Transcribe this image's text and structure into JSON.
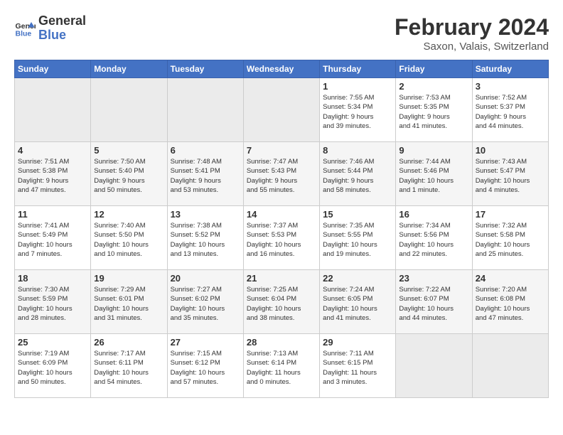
{
  "header": {
    "logo_line1": "General",
    "logo_line2": "Blue",
    "month": "February 2024",
    "location": "Saxon, Valais, Switzerland"
  },
  "weekdays": [
    "Sunday",
    "Monday",
    "Tuesday",
    "Wednesday",
    "Thursday",
    "Friday",
    "Saturday"
  ],
  "weeks": [
    [
      {
        "day": "",
        "info": ""
      },
      {
        "day": "",
        "info": ""
      },
      {
        "day": "",
        "info": ""
      },
      {
        "day": "",
        "info": ""
      },
      {
        "day": "1",
        "info": "Sunrise: 7:55 AM\nSunset: 5:34 PM\nDaylight: 9 hours\nand 39 minutes."
      },
      {
        "day": "2",
        "info": "Sunrise: 7:53 AM\nSunset: 5:35 PM\nDaylight: 9 hours\nand 41 minutes."
      },
      {
        "day": "3",
        "info": "Sunrise: 7:52 AM\nSunset: 5:37 PM\nDaylight: 9 hours\nand 44 minutes."
      }
    ],
    [
      {
        "day": "4",
        "info": "Sunrise: 7:51 AM\nSunset: 5:38 PM\nDaylight: 9 hours\nand 47 minutes."
      },
      {
        "day": "5",
        "info": "Sunrise: 7:50 AM\nSunset: 5:40 PM\nDaylight: 9 hours\nand 50 minutes."
      },
      {
        "day": "6",
        "info": "Sunrise: 7:48 AM\nSunset: 5:41 PM\nDaylight: 9 hours\nand 53 minutes."
      },
      {
        "day": "7",
        "info": "Sunrise: 7:47 AM\nSunset: 5:43 PM\nDaylight: 9 hours\nand 55 minutes."
      },
      {
        "day": "8",
        "info": "Sunrise: 7:46 AM\nSunset: 5:44 PM\nDaylight: 9 hours\nand 58 minutes."
      },
      {
        "day": "9",
        "info": "Sunrise: 7:44 AM\nSunset: 5:46 PM\nDaylight: 10 hours\nand 1 minute."
      },
      {
        "day": "10",
        "info": "Sunrise: 7:43 AM\nSunset: 5:47 PM\nDaylight: 10 hours\nand 4 minutes."
      }
    ],
    [
      {
        "day": "11",
        "info": "Sunrise: 7:41 AM\nSunset: 5:49 PM\nDaylight: 10 hours\nand 7 minutes."
      },
      {
        "day": "12",
        "info": "Sunrise: 7:40 AM\nSunset: 5:50 PM\nDaylight: 10 hours\nand 10 minutes."
      },
      {
        "day": "13",
        "info": "Sunrise: 7:38 AM\nSunset: 5:52 PM\nDaylight: 10 hours\nand 13 minutes."
      },
      {
        "day": "14",
        "info": "Sunrise: 7:37 AM\nSunset: 5:53 PM\nDaylight: 10 hours\nand 16 minutes."
      },
      {
        "day": "15",
        "info": "Sunrise: 7:35 AM\nSunset: 5:55 PM\nDaylight: 10 hours\nand 19 minutes."
      },
      {
        "day": "16",
        "info": "Sunrise: 7:34 AM\nSunset: 5:56 PM\nDaylight: 10 hours\nand 22 minutes."
      },
      {
        "day": "17",
        "info": "Sunrise: 7:32 AM\nSunset: 5:58 PM\nDaylight: 10 hours\nand 25 minutes."
      }
    ],
    [
      {
        "day": "18",
        "info": "Sunrise: 7:30 AM\nSunset: 5:59 PM\nDaylight: 10 hours\nand 28 minutes."
      },
      {
        "day": "19",
        "info": "Sunrise: 7:29 AM\nSunset: 6:01 PM\nDaylight: 10 hours\nand 31 minutes."
      },
      {
        "day": "20",
        "info": "Sunrise: 7:27 AM\nSunset: 6:02 PM\nDaylight: 10 hours\nand 35 minutes."
      },
      {
        "day": "21",
        "info": "Sunrise: 7:25 AM\nSunset: 6:04 PM\nDaylight: 10 hours\nand 38 minutes."
      },
      {
        "day": "22",
        "info": "Sunrise: 7:24 AM\nSunset: 6:05 PM\nDaylight: 10 hours\nand 41 minutes."
      },
      {
        "day": "23",
        "info": "Sunrise: 7:22 AM\nSunset: 6:07 PM\nDaylight: 10 hours\nand 44 minutes."
      },
      {
        "day": "24",
        "info": "Sunrise: 7:20 AM\nSunset: 6:08 PM\nDaylight: 10 hours\nand 47 minutes."
      }
    ],
    [
      {
        "day": "25",
        "info": "Sunrise: 7:19 AM\nSunset: 6:09 PM\nDaylight: 10 hours\nand 50 minutes."
      },
      {
        "day": "26",
        "info": "Sunrise: 7:17 AM\nSunset: 6:11 PM\nDaylight: 10 hours\nand 54 minutes."
      },
      {
        "day": "27",
        "info": "Sunrise: 7:15 AM\nSunset: 6:12 PM\nDaylight: 10 hours\nand 57 minutes."
      },
      {
        "day": "28",
        "info": "Sunrise: 7:13 AM\nSunset: 6:14 PM\nDaylight: 11 hours\nand 0 minutes."
      },
      {
        "day": "29",
        "info": "Sunrise: 7:11 AM\nSunset: 6:15 PM\nDaylight: 11 hours\nand 3 minutes."
      },
      {
        "day": "",
        "info": ""
      },
      {
        "day": "",
        "info": ""
      }
    ]
  ]
}
